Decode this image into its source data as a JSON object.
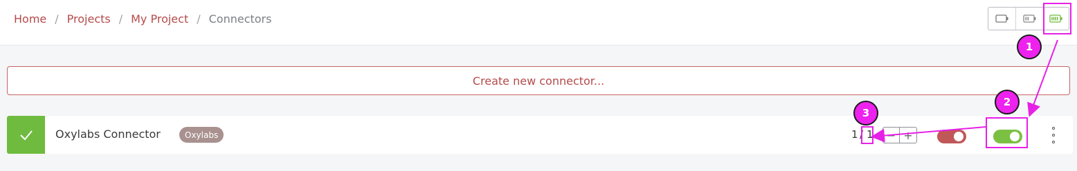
{
  "breadcrumb": {
    "items": [
      "Home",
      "Projects",
      "My Project"
    ],
    "current": "Connectors",
    "separator": "/"
  },
  "view_switch": {
    "options": [
      "battery-empty-icon",
      "battery-half-icon",
      "battery-full-icon"
    ],
    "active": "battery-full-icon"
  },
  "create_button": {
    "label": "Create new connector..."
  },
  "connector": {
    "status_icon": "checkmark-icon",
    "name": "Oxylabs Connector",
    "tag": "Oxylabs",
    "count_current": "1",
    "count_separator": "/",
    "count_total": "1",
    "decrement_label": "−",
    "increment_label": "+",
    "toggle_red_on": true,
    "toggle_green_on": true
  },
  "annotations": {
    "badge_1": "1",
    "badge_2": "2",
    "badge_3": "3"
  },
  "colors": {
    "accent_red": "#b54a4a",
    "success_green": "#6fbb3f",
    "annotation_magenta": "#ee22ee"
  }
}
